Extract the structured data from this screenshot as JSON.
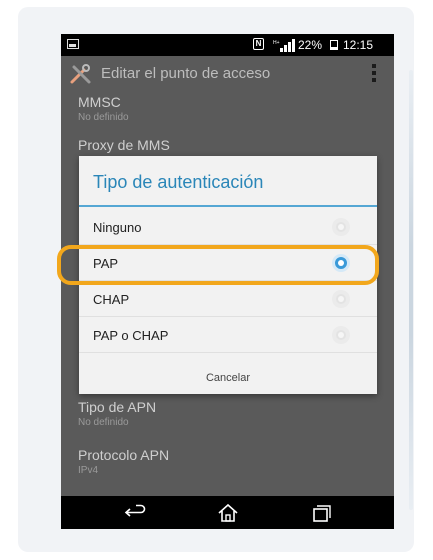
{
  "status_bar": {
    "battery_percent": "22%",
    "time": "12:15",
    "icons": [
      "gallery-icon",
      "nfc-icon",
      "signal-icon",
      "battery-icon"
    ],
    "nfc_glyph": "N"
  },
  "app_bar": {
    "title": "Editar el punto de acceso",
    "icons": [
      "tools-icon",
      "overflow-menu-icon"
    ]
  },
  "background_list": [
    {
      "title": "MMSC",
      "summary": "No definido"
    },
    {
      "title": "Proxy de MMS",
      "summary": ""
    },
    {
      "title": "Tipo de APN",
      "summary": "No definido"
    },
    {
      "title": "Protocolo APN",
      "summary": "IPv4"
    }
  ],
  "dialog": {
    "title": "Tipo de autenticación",
    "options": [
      {
        "label": "Ninguno",
        "selected": false
      },
      {
        "label": "PAP",
        "selected": true
      },
      {
        "label": "CHAP",
        "selected": false
      },
      {
        "label": "PAP o CHAP",
        "selected": false
      }
    ],
    "cancel_label": "Cancelar"
  },
  "nav_bar": {
    "icons": [
      "back-icon",
      "home-icon",
      "recents-icon"
    ]
  },
  "colors": {
    "accent": "#2a86b8",
    "highlight": "#f2a71c",
    "radio_selected": "#3a9ad9"
  }
}
